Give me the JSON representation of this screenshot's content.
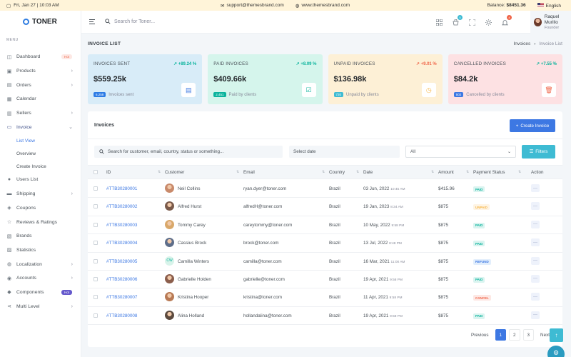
{
  "topbar": {
    "datetime": "Fri, Jan 27 | 10:03 AM",
    "email": "support@themesbrand.com",
    "website": "www.themesbrand.com",
    "balance_label": "Balance:",
    "balance_value": "$8451.36",
    "language": "English"
  },
  "brand": {
    "name": "TONER",
    "color": "#2f7de1"
  },
  "sidebar": {
    "menu_title": "MENU",
    "items": [
      {
        "label": "Dashboard",
        "icon": "dashboard-icon",
        "badge": "Hot"
      },
      {
        "label": "Products",
        "icon": "box-icon",
        "chevron": true
      },
      {
        "label": "Orders",
        "icon": "cart-icon",
        "chevron": true
      },
      {
        "label": "Calendar",
        "icon": "calendar-icon"
      },
      {
        "label": "Sellers",
        "icon": "store-icon",
        "chevron": true
      },
      {
        "label": "Invoice",
        "icon": "invoice-icon",
        "chevron": true,
        "active": true
      }
    ],
    "sub_items": [
      {
        "label": "List View",
        "active": true
      },
      {
        "label": "Overview"
      },
      {
        "label": "Create Invoice"
      }
    ],
    "items2": [
      {
        "label": "Users List",
        "icon": "user-icon"
      },
      {
        "label": "Shipping",
        "icon": "truck-icon",
        "chevron": true
      },
      {
        "label": "Coupons",
        "icon": "coupon-icon"
      },
      {
        "label": "Reviews & Ratings",
        "icon": "star-icon"
      },
      {
        "label": "Brands",
        "icon": "brand-icon"
      },
      {
        "label": "Statistics",
        "icon": "chart-icon"
      },
      {
        "label": "Localization",
        "icon": "globe-icon",
        "chevron": true
      },
      {
        "label": "Accounts",
        "icon": "account-icon",
        "chevron": true
      },
      {
        "label": "Components",
        "icon": "layers-icon",
        "badge": "Hot"
      },
      {
        "label": "Multi Level",
        "icon": "share-icon",
        "chevron": true
      }
    ]
  },
  "header": {
    "search_placeholder": "Search for Toner...",
    "cart_badge": "5",
    "bell_badge": "4",
    "user_name": "Raquel Murillo",
    "user_role": "Founder"
  },
  "page": {
    "title": "INVOICE LIST",
    "breadcrumb": [
      "Invoices",
      "Invoice List"
    ]
  },
  "cards": [
    {
      "title": "INVOICES SENT",
      "pct": "+89.24 %",
      "value": "$559.25k",
      "count": "6,258",
      "caption": "Invoices sent",
      "bg": "#d8ecf8",
      "pct_color": "#0ab39c",
      "count_bg": "#2c7be5",
      "icon_color": "#3d78e3",
      "icon": "file-icon"
    },
    {
      "title": "PAID INVOICES",
      "pct": "+8.09 %",
      "value": "$409.66k",
      "count": "2,451",
      "caption": "Paid by clients",
      "bg": "#d5f5ec",
      "pct_color": "#0ab39c",
      "count_bg": "#0ab39c",
      "icon_color": "#0ab39c",
      "icon": "check-file-icon"
    },
    {
      "title": "UNPAID INVOICES",
      "pct": "+9.01 %",
      "value": "$136.98k",
      "count": "720",
      "caption": "Unpaid by clients",
      "bg": "#fdf0d6",
      "pct_color": "#f06548",
      "count_bg": "#3ebbd3",
      "icon_color": "#f7b84b",
      "icon": "clock-icon"
    },
    {
      "title": "CANCELLED INVOICES",
      "pct": "+7.55 %",
      "value": "$84.2k",
      "count": "502",
      "caption": "Cancelled by clients",
      "bg": "#fde1e3",
      "pct_color": "#0ab39c",
      "count_bg": "#3d78e3",
      "icon_color": "#f06548",
      "icon": "trash-icon"
    }
  ],
  "invoices": {
    "title": "Invoices",
    "create_label": "Create Invoice",
    "search_placeholder": "Search for customer, email, country, status or something...",
    "date_placeholder": "Select date",
    "status_select": "All",
    "filters_label": "Filters",
    "columns": [
      "ID",
      "Customer",
      "Email",
      "Country",
      "Date",
      "Amount",
      "Payment Status",
      "Action"
    ],
    "rows": [
      {
        "id": "#TTB30280001",
        "customer": "Neil Collins",
        "email": "ryan.dyer@toner.com",
        "country": "Brazil",
        "date": "03 Jun, 2022",
        "time": "10:45 AM",
        "amount": "$415.96",
        "status": "PAID",
        "avatar": "#c98a6b"
      },
      {
        "id": "#TTB30280002",
        "customer": "Alfred Hurst",
        "email": "alfredH@toner.com",
        "country": "Brazil",
        "date": "19 Jan, 2023",
        "time": "8:34 AM",
        "amount": "$875",
        "status": "UNPAID",
        "avatar": "#7a5a4a"
      },
      {
        "id": "#TTB30280003",
        "customer": "Tommy Carey",
        "email": "careytommy@toner.com",
        "country": "Brazil",
        "date": "10 May, 2022",
        "time": "9:58 PM",
        "amount": "$875",
        "status": "PAID",
        "avatar": "#d9a86a"
      },
      {
        "id": "#TTB30280004",
        "customer": "Cassius Brock",
        "email": "brock@toner.com",
        "country": "Brazil",
        "date": "13 Jul, 2022",
        "time": "8:48 PM",
        "amount": "$875",
        "status": "PAID",
        "avatar": "#5e6e8a"
      },
      {
        "id": "#TTB30280005",
        "customer": "Camilla Winters",
        "email": "camilla@toner.com",
        "country": "Brazil",
        "date": "16 Mar, 2021",
        "time": "11:00 AM",
        "amount": "$875",
        "status": "REFUND",
        "initials": "CW"
      },
      {
        "id": "#TTB30280006",
        "customer": "Gabrielle Holden",
        "email": "gabrielle@toner.com",
        "country": "Brazil",
        "date": "19 Apr, 2021",
        "time": "9:58 PM",
        "amount": "$875",
        "status": "PAID",
        "avatar": "#8b5e4c"
      },
      {
        "id": "#TTB30280007",
        "customer": "Kristina Hooper",
        "email": "kristina@toner.com",
        "country": "Brazil",
        "date": "11 Apr, 2021",
        "time": "9:58 PM",
        "amount": "$875",
        "status": "CANCEL",
        "avatar": "#b87a55"
      },
      {
        "id": "#TTB30280008",
        "customer": "Alina Holland",
        "email": "hollandalina@toner.com",
        "country": "Brazil",
        "date": "19 Apr, 2021",
        "time": "9:58 PM",
        "amount": "$875",
        "status": "PAID",
        "avatar": "#5c4a3e"
      }
    ],
    "status_colors": {
      "PAID": [
        "#daf4f0",
        "#0ab39c"
      ],
      "UNPAID": [
        "#fef4e4",
        "#f7b84b"
      ],
      "REFUND": [
        "#e2eefc",
        "#3d78e3"
      ],
      "CANCEL": [
        "#fde8e4",
        "#f06548"
      ]
    },
    "pager": {
      "prev": "Previous",
      "pages": [
        "1",
        "2",
        "3"
      ],
      "next": "Next"
    }
  }
}
